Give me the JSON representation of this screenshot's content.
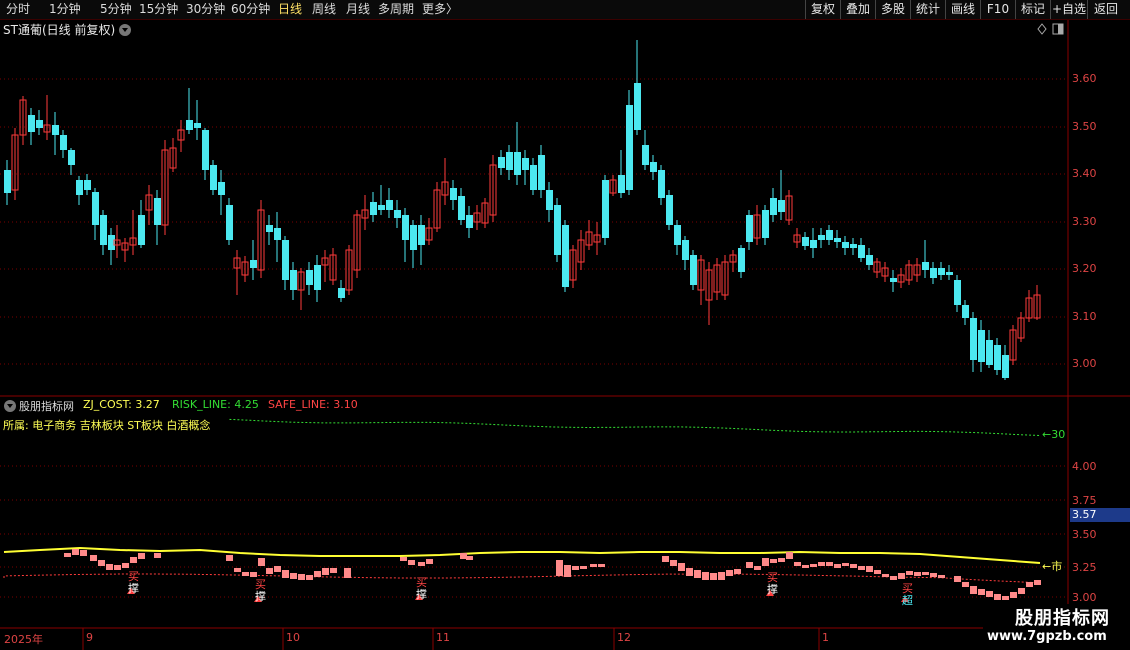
{
  "toolbar": {
    "periods": [
      "分时",
      "1分钟",
      "5分钟",
      "15分钟",
      "30分钟",
      "60分钟",
      "日线",
      "周线",
      "月线",
      "多周期",
      "更多"
    ],
    "active_period": "日线",
    "more_arrow": "〉",
    "right_buttons": [
      "复权",
      "叠加",
      "多股",
      "统计",
      "画线",
      "F10",
      "标记",
      "+自选",
      "返回"
    ]
  },
  "stock": {
    "title": "ST通葡(日线 前复权)"
  },
  "price_axis": [
    "3.60",
    "3.50",
    "3.40",
    "3.30",
    "3.20",
    "3.10",
    "3.00"
  ],
  "indicator": {
    "name": "股朋指标网",
    "zj_cost_label": "ZJ_COST: 3.27",
    "risk_line_label": "RISK_LINE: 4.25",
    "safe_line_label": "SAFE_LINE: 3.10",
    "concepts": "所属: 电子商务 吉林板块 ST板块 白酒概念",
    "line_marker": "←30",
    "market_marker": "←市",
    "axis": [
      "4.00",
      "3.75",
      "3.50",
      "3.25",
      "3.00"
    ],
    "current_value": "3.57",
    "signals": [
      {
        "top": "买",
        "bottom": "撑"
      },
      {
        "top": "买",
        "bottom": "撑"
      },
      {
        "top": "买",
        "bottom": "撑"
      },
      {
        "top": "买",
        "bottom": "撑"
      },
      {
        "top": "买",
        "bottom": "超"
      }
    ]
  },
  "date_axis": [
    "2025年",
    "9",
    "10",
    "11",
    "12",
    "1"
  ],
  "watermark": {
    "name": "股朋指标网",
    "url": "www.7gpzb.com"
  },
  "colors": {
    "up": "#ff3b3b",
    "down": "#4ce8f0",
    "cost_line": "#ffff33",
    "risk_line": "#33dd33",
    "grid": "#7a0000"
  }
}
